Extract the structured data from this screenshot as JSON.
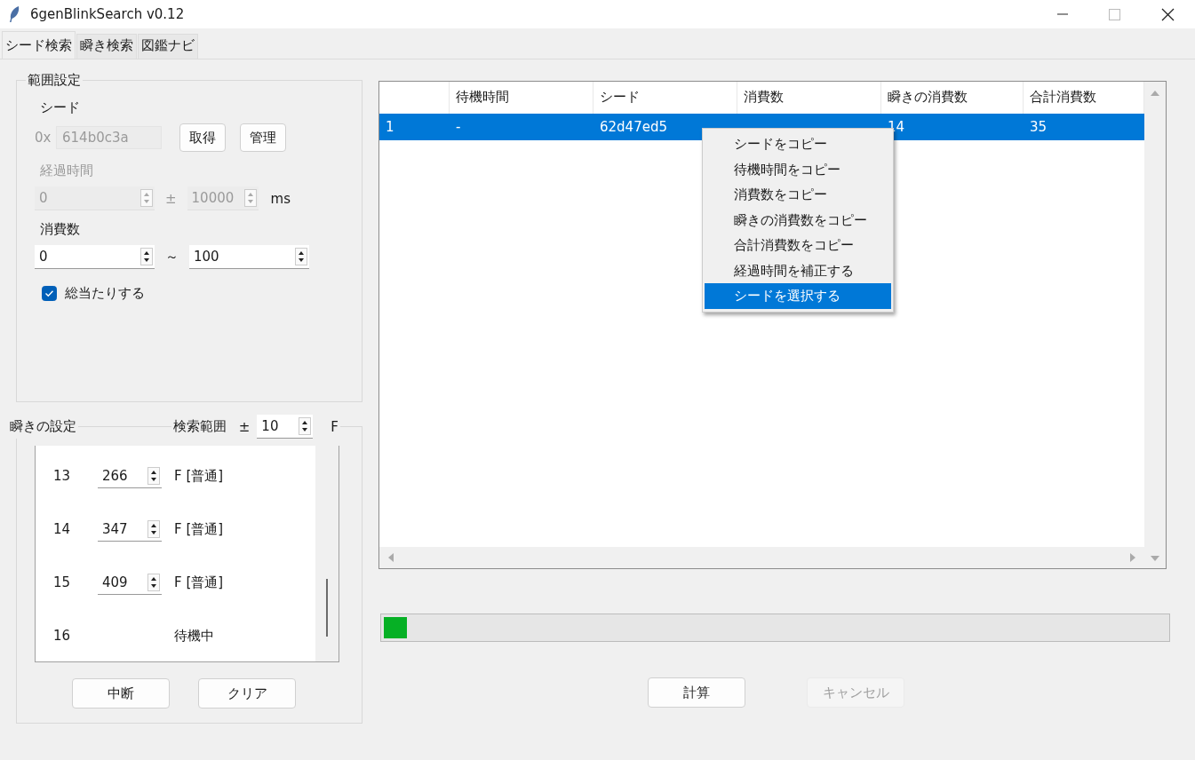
{
  "window": {
    "title": "6genBlinkSearch v0.12"
  },
  "tabs": [
    {
      "label": "シード検索",
      "selected": true
    },
    {
      "label": "瞬き検索",
      "selected": false
    },
    {
      "label": "図鑑ナビ",
      "selected": false
    }
  ],
  "range_settings": {
    "title": "範囲設定",
    "seed": {
      "label": "シード",
      "prefix": "0x",
      "value": "614b0c3a",
      "disabled": true
    },
    "seed_buttons": [
      "取得",
      "管理"
    ],
    "elapsed": {
      "label": "経過時間",
      "value": "0",
      "plus_minus": "±",
      "range": "10000",
      "unit": "ms",
      "disabled": true
    },
    "consumption": {
      "label": "消費数",
      "from": "0",
      "tilde": "～",
      "to": "100"
    },
    "brute_force": {
      "label": "総当たりする",
      "checked": true
    }
  },
  "blink_settings": {
    "title": "瞬きの設定",
    "search_range_label": "検索範囲",
    "plus_minus": "±",
    "search_range": "10",
    "unit": "F",
    "rows": [
      {
        "index": "13",
        "frame": "266",
        "status": "F [普通]"
      },
      {
        "index": "14",
        "frame": "347",
        "status": "F [普通]"
      },
      {
        "index": "15",
        "frame": "409",
        "status": "F [普通]"
      },
      {
        "index": "16",
        "status": "待機中"
      }
    ],
    "buttons": [
      "中断",
      "クリア"
    ]
  },
  "results": {
    "columns": [
      "",
      "待機時間",
      "シード",
      "消費数",
      "瞬きの消費数",
      "合計消費数"
    ],
    "rows": [
      {
        "cells": [
          "1",
          "-",
          "62d47ed5",
          "",
          "14",
          "35"
        ],
        "selected": true
      }
    ]
  },
  "context_menu": {
    "items": [
      {
        "label": "シードをコピー",
        "selected": false
      },
      {
        "label": "待機時間をコピー",
        "selected": false
      },
      {
        "label": "消費数をコピー",
        "selected": false
      },
      {
        "label": "瞬きの消費数をコピー",
        "selected": false
      },
      {
        "label": "合計消費数をコピー",
        "selected": false
      },
      {
        "label": "経過時間を補正する",
        "selected": false
      },
      {
        "label": "シードを選択する",
        "selected": true
      }
    ]
  },
  "progress": {
    "level": 0.03
  },
  "actions": [
    {
      "label": "計算",
      "disabled": false
    },
    {
      "label": "キャンセル",
      "disabled": true
    }
  ]
}
